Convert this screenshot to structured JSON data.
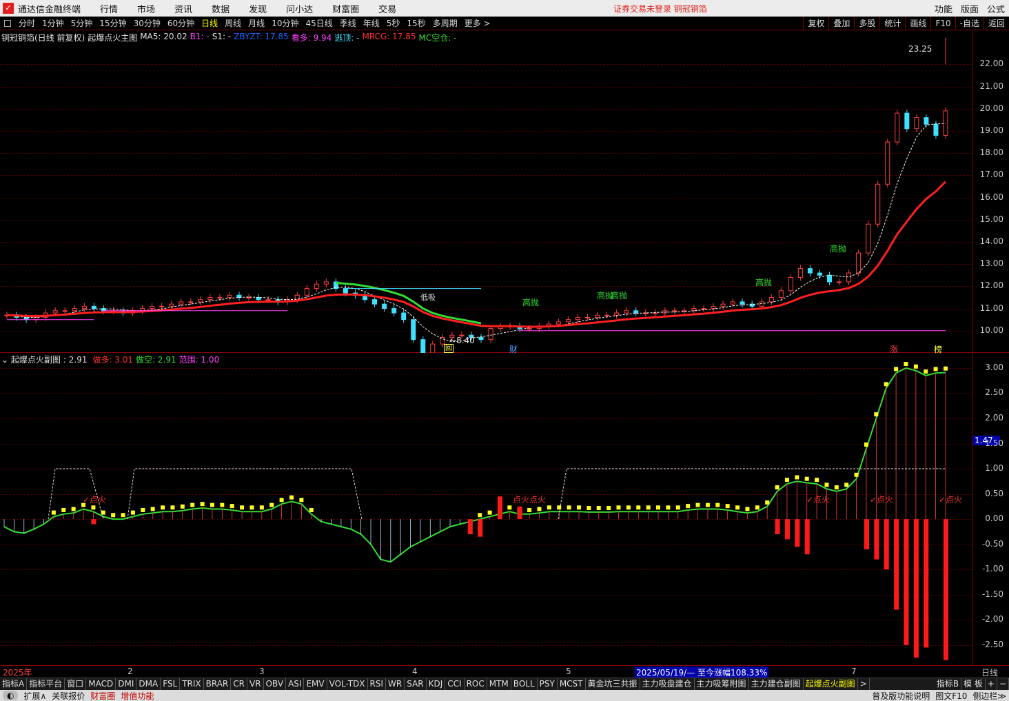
{
  "app": {
    "title": "通达信金融终端",
    "logo": "tdx-logo",
    "warning": "证券交易未登录  铜冠铜箔"
  },
  "menu": [
    "行情",
    "市场",
    "资讯",
    "数据",
    "发现",
    "问小达",
    "财富圈",
    "交易"
  ],
  "menu_right": [
    "功能",
    "版面",
    "公式"
  ],
  "periods": [
    "分时",
    "1分钟",
    "5分钟",
    "15分钟",
    "30分钟",
    "60分钟",
    "日线",
    "周线",
    "月线",
    "10分钟",
    "45日线",
    "季线",
    "年线",
    "5秒",
    "15秒",
    "多周期",
    "更多 >"
  ],
  "active_period": "日线",
  "tools": [
    "复权",
    "叠加",
    "多股",
    "统计",
    "画线",
    "F10",
    "-自选",
    "返回"
  ],
  "main_legend": {
    "stock": "铜冠铜箔(日线 前复权)",
    "indicator": "起爆点火主图",
    "ma5": "MA5: 20.02",
    "b1": "B1: -",
    "s1": "S1: -",
    "zbyzt": "ZBYZT: 17.85",
    "kanduo": "看多: 9.94",
    "taoding": "逃顶: -",
    "mrcg": "MRCG: 17.85",
    "mc": "MC空仓: -"
  },
  "main_axis": [
    "22.00",
    "21.00",
    "20.00",
    "19.00",
    "18.00",
    "17.00",
    "16.00",
    "15.00",
    "14.00",
    "13.00",
    "12.00",
    "11.00",
    "10.00"
  ],
  "main_labels": {
    "high": "23.25",
    "low": "8.40",
    "gaopao": "高抛",
    "dixi": "低吸",
    "hui": "回",
    "cai": "财",
    "zhang": "涨",
    "bang": "榜"
  },
  "sub_legend": {
    "name": "起爆点火副图",
    "value": ": 2.91",
    "zuoduo": "做多: 3.01",
    "zuokong": "做空: 2.91",
    "fanwei": "范围: 1.00"
  },
  "sub_axis": [
    "3.00",
    "2.50",
    "2.00",
    "1.50",
    "1.00",
    "0.50",
    "0.00",
    "-0.50",
    "-1.00",
    "-1.50",
    "-2.00",
    "-2.50"
  ],
  "sub_marker": "1.47",
  "sub_labels": {
    "dianhuo": "✓点火",
    "dianhuo2": "点火点火"
  },
  "time_axis": {
    "year": "2025年",
    "months": [
      "2",
      "3",
      "4",
      "5",
      "7"
    ],
    "info": "2025/05/19/— 至今涨幅108.33%",
    "period": "日线"
  },
  "tabs": [
    "指标A",
    "指标平台",
    "窗口",
    "MACD",
    "DMI",
    "DMA",
    "FSL",
    "TRIX",
    "BRAR",
    "CR",
    "VR",
    "OBV",
    "ASI",
    "EMV",
    "VOL-TDX",
    "RSI",
    "WR",
    "SAR",
    "KDJ",
    "CCI",
    "ROC",
    "MTM",
    "BOLL",
    "PSY",
    "MCST",
    "黄金坑三共振",
    "主力吸盘建仓",
    "主力吸筹附图",
    "主力建仓副图",
    "起爆点火副图",
    ">"
  ],
  "active_tab": "起爆点火副图",
  "tabs_right": [
    "指标B",
    "模 板",
    "+",
    "−"
  ],
  "status": [
    "扩展∧",
    "关联报价",
    "财富圈",
    "增值功能"
  ],
  "status_right": [
    "普及版功能说明",
    "图文F10",
    "侧边栏≫"
  ],
  "chart_data": [
    {
      "type": "candlestick",
      "title": "起爆点火主图",
      "ylim": [
        9,
        23.5
      ],
      "lines": [
        {
          "name": "MA5",
          "color": "#ffffff"
        },
        {
          "name": "ZBYZT",
          "color": "#ff2020"
        },
        {
          "name": "MRCG",
          "color": "#33dd33"
        }
      ]
    },
    {
      "type": "bar",
      "title": "起爆点火副图",
      "ylim": [
        -2.9,
        3.3
      ],
      "series": [
        {
          "name": "做多",
          "values": [
            3.01
          ]
        },
        {
          "name": "做空",
          "values": [
            2.91
          ]
        },
        {
          "name": "范围",
          "values": [
            1.0
          ]
        }
      ]
    }
  ]
}
